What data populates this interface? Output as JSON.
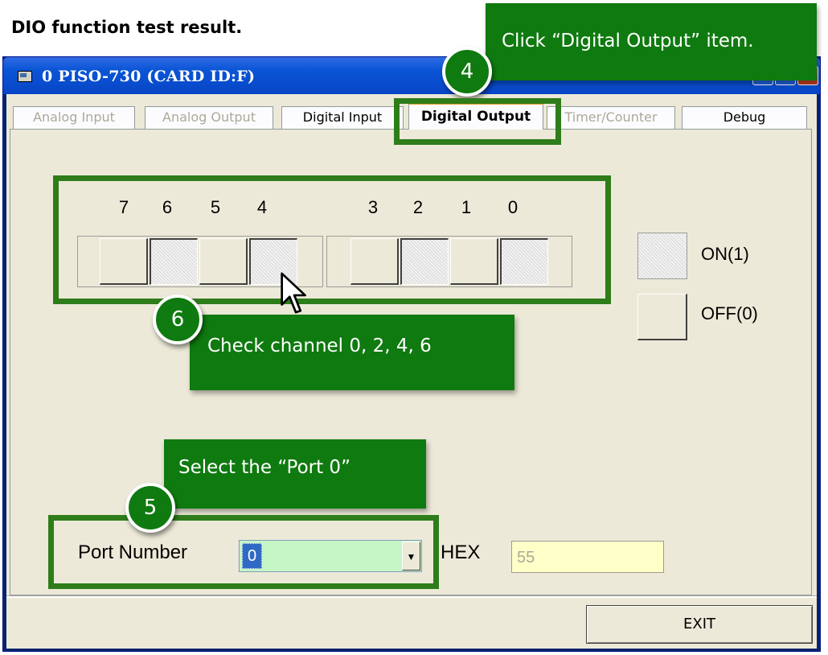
{
  "document": {
    "heading": "DIO function test result."
  },
  "window": {
    "title": "0 PISO-730 (CARD ID:F)"
  },
  "tabs": [
    {
      "label": "Analog Input",
      "state": "disabled"
    },
    {
      "label": "Analog Output",
      "state": "disabled"
    },
    {
      "label": "Digital Input",
      "state": "enabled"
    },
    {
      "label": "Digital Output",
      "state": "active"
    },
    {
      "label": "Timer/Counter",
      "state": "disabled"
    },
    {
      "label": "Debug",
      "state": "enabled"
    }
  ],
  "digital_output": {
    "bit_labels": [
      "7",
      "6",
      "5",
      "4",
      "3",
      "2",
      "1",
      "0"
    ],
    "bit_states": [
      false,
      true,
      false,
      true,
      false,
      true,
      false,
      true
    ],
    "legend_on": "ON(1)",
    "legend_off": "OFF(0)"
  },
  "port": {
    "label": "Port Number",
    "selected": "0"
  },
  "hex": {
    "label": "HEX",
    "value": "55"
  },
  "exit_label": "EXIT",
  "annotations": {
    "step4": {
      "number": "4",
      "text": "Click “Digital Output” item."
    },
    "step5": {
      "number": "5",
      "text": "Select the “Port 0”"
    },
    "step6": {
      "number": "6",
      "text": "Check channel 0, 2, 4, 6"
    }
  },
  "colors": {
    "annotation_green": "#0f7a0f",
    "highlight_green": "#2e7d1a",
    "titlebar_blue": "#0a55d6",
    "client_bg": "#ece9d8",
    "port_field_bg": "#c6f5c6",
    "hex_field_bg": "#ffffc8"
  }
}
